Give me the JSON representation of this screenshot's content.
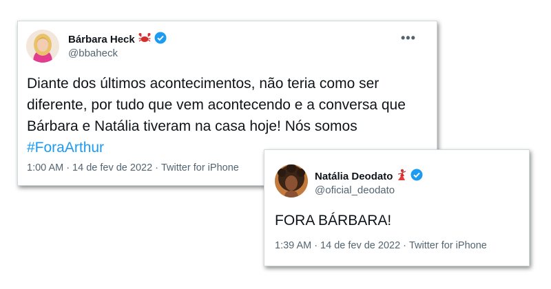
{
  "tweets": [
    {
      "display_name": "Bárbara Heck",
      "name_emoji": "crab-emoji",
      "handle": "@bbaheck",
      "more_label": "•••",
      "text": "Diante dos últimos acontecimentos, não teria como ser diferente, por tudo que vem acontecendo e a conversa que Bárbara e Natália tiveram na casa hoje! Nós somos",
      "hashtag": "#ForaArthur",
      "time": "1:00 AM",
      "date": "14 de fev de 2022",
      "source": "Twitter for iPhone",
      "separator": "·"
    },
    {
      "display_name": "Natália Deodato",
      "name_emoji": "dancer-emoji",
      "handle": "@oficial_deodato",
      "text": "FORA BÁRBARA!",
      "time": "1:39 AM",
      "date": "14 de fev de 2022",
      "source": "Twitter for iPhone",
      "separator": "·"
    }
  ],
  "colors": {
    "hashtag": "#1d9bf0",
    "verified": "#1d9bf0",
    "secondary_text": "#536471"
  }
}
